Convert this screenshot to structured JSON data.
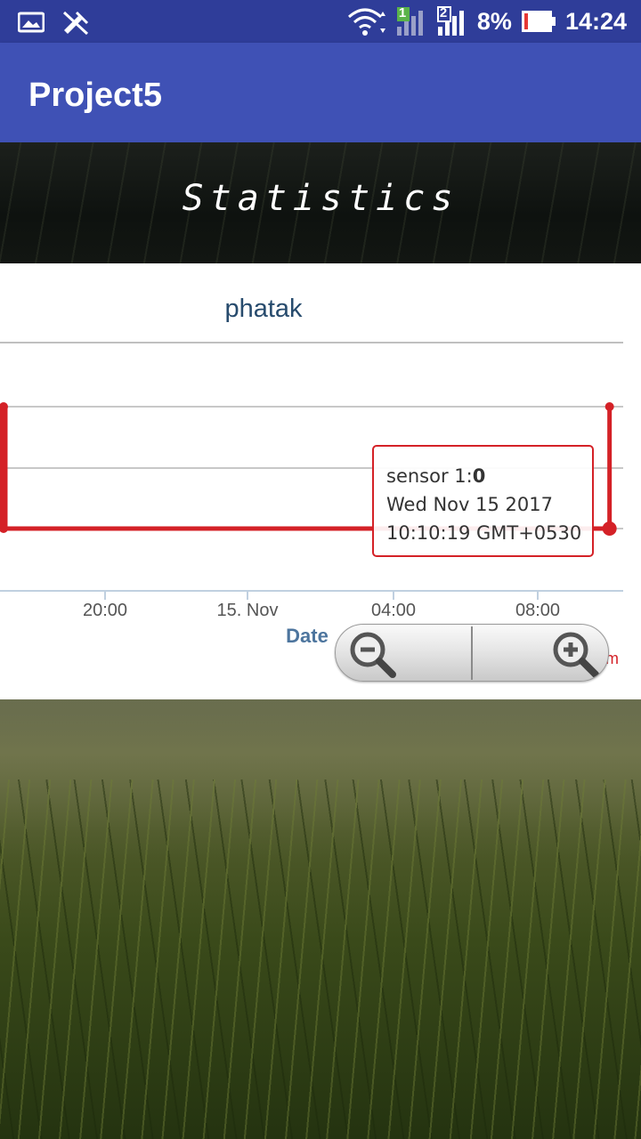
{
  "status_bar": {
    "battery": "8%",
    "time": "14:24",
    "sim1": "1",
    "sim2": "2",
    "icons": [
      "image-icon",
      "signal-off-icon",
      "wifi-icon",
      "signal-icon",
      "battery-icon"
    ]
  },
  "app_bar": {
    "title": "Project5"
  },
  "banner": {
    "title": "Statistics"
  },
  "colors": {
    "primary": "#3f51b5",
    "status_bar": "#2f3d99",
    "series": "#d42127",
    "title_text": "#274b6d"
  },
  "chart_data": {
    "type": "line",
    "title": "phatak",
    "xlabel": "Date",
    "x_ticks": [
      "20:00",
      "15. Nov",
      "04:00",
      "08:00"
    ],
    "series": [
      {
        "name": "sensor 1",
        "points": [
          {
            "x": "2017-11-14 16:30",
            "y": 1
          },
          {
            "x": "2017-11-14 16:30",
            "y": 0
          },
          {
            "x": "2017-11-15 10:10",
            "y": 0
          },
          {
            "x": "2017-11-15 10:10",
            "y": 1
          }
        ]
      }
    ],
    "tooltip": {
      "series_prefix": "sensor 1:",
      "value": "0",
      "line2": "Wed Nov 15 2017",
      "line3": "10:10:19 GMT+0530"
    },
    "legend_partial": "m",
    "grid": true
  },
  "zoom": {
    "icons": [
      "zoom-out-icon",
      "zoom-in-icon"
    ]
  }
}
